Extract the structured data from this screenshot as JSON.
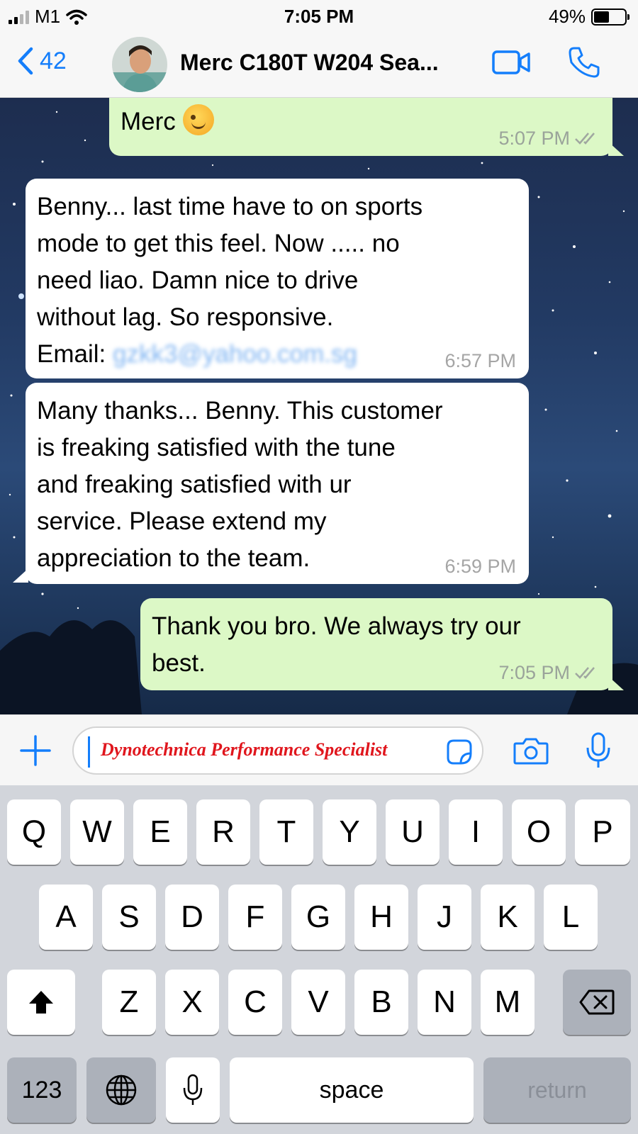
{
  "status_bar": {
    "carrier": "M1",
    "time": "7:05 PM",
    "battery": "49%",
    "battery_level": 0.49
  },
  "header": {
    "back_count": "42",
    "chat_title": "Merc C180T W204 Sea..."
  },
  "messages": [
    {
      "direction": "outgoing",
      "text": "Merc",
      "emoji": "wink",
      "time": "5:07 PM",
      "status": "read"
    },
    {
      "direction": "incoming",
      "lines": [
        "Benny... last time have to on sports",
        "mode to get this feel. Now ..... no",
        "need liao. Damn nice to drive",
        "without lag. So responsive."
      ],
      "email_label": "Email:",
      "email_redacted": "gzkk3@yahoo.com.sg",
      "time": "6:57 PM"
    },
    {
      "direction": "incoming",
      "lines": [
        "Many thanks... Benny. This customer",
        "is freaking satisfied with the tune",
        "and freaking satisfied with ur",
        "service. Please extend my",
        "appreciation to the team."
      ],
      "time": "6:59 PM"
    },
    {
      "direction": "outgoing",
      "lines": [
        "Thank you bro. We always try our",
        "best."
      ],
      "time": "7:05 PM",
      "status": "read"
    }
  ],
  "input": {
    "text": "Dynotechnica Performance Specialist"
  },
  "keyboard": {
    "row1": [
      "Q",
      "W",
      "E",
      "R",
      "T",
      "Y",
      "U",
      "I",
      "O",
      "P"
    ],
    "row2": [
      "A",
      "S",
      "D",
      "F",
      "G",
      "H",
      "J",
      "K",
      "L"
    ],
    "row3": [
      "Z",
      "X",
      "C",
      "V",
      "B",
      "N",
      "M"
    ],
    "numbers_label": "123",
    "space_label": "space",
    "return_label": "return"
  },
  "colors": {
    "accent": "#147efb",
    "outgoing_bubble": "#dcf8c6",
    "incoming_bubble": "#ffffff",
    "input_text": "#e0161d"
  }
}
